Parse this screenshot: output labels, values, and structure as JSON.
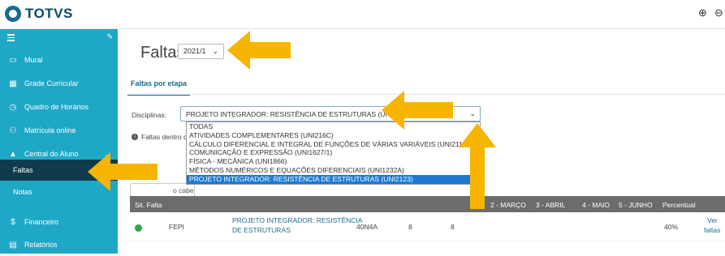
{
  "brand": {
    "name": "TOTVS"
  },
  "zoom": {
    "in_icon": "⊕",
    "out_icon": "⊖"
  },
  "sidebar": {
    "items": [
      {
        "label": "Mural",
        "icon": "monitor-icon"
      },
      {
        "label": "Grade Curricular",
        "icon": "grid-icon"
      },
      {
        "label": "Quadro de Horários",
        "icon": "clock-icon"
      },
      {
        "label": "Matrícula online",
        "icon": "user-plus-icon"
      },
      {
        "label": "Central do Aluno",
        "icon": "graduation-cap-icon"
      },
      {
        "label": "Faltas",
        "icon": ""
      },
      {
        "label": "Notas",
        "icon": ""
      },
      {
        "label": "Financeiro",
        "icon": "dollar-icon"
      },
      {
        "label": "Relatórios",
        "icon": "document-icon"
      }
    ]
  },
  "main": {
    "title": "Faltas:",
    "period": "2021/1",
    "tab": "Faltas por etapa",
    "disciplinas_label": "Disciplinas:",
    "disciplinas_value": "PROJETO INTEGRADOR: RESISTÊNCIA DE ESTRUTURAS (UNI2123)",
    "disciplinas_options": [
      "TODAS",
      "ATIVIDADES COMPLEMENTARES (UNI216C)",
      "CÁLCULO DIFERENCIAL E INTEGRAL DE FUNÇÕES DE VÁRIAS VARIÁVEIS (UNI2118A)",
      "COMUNICAÇÃO E EXPRESSÃO (UNI1627/1)",
      "FÍSICA - MECÂNICA (UNI1866)",
      "MÉTODOS NUMÉRICOS E EQUAÇÕES DIFERENCIAIS (UNI1232A)",
      "PROJETO INTEGRADOR: RESISTÊNCIA DE ESTRUTURAS (UNI2123)"
    ],
    "info_text": "Faltas dentro d",
    "cabecalho_label": "o cabe",
    "table": {
      "headers": [
        "Sit. Falta",
        "2 - MARÇO",
        "3 - ABRIL",
        "4 - MAIO",
        "5 - JUNHO",
        "Percentual"
      ],
      "row": {
        "code": "FEPI",
        "discipline_line1": "PROJETO INTEGRADOR: RESISTÊNCIA",
        "discipline_line2": "DE ESTRUTURAS",
        "turma": "40N4A",
        "val1": "8",
        "val2": "8",
        "percent": "40%",
        "link1": "Ver",
        "link2": "faltas"
      }
    }
  },
  "colors": {
    "sidebar": "#1fa7c6",
    "active": "#0f3b4d",
    "arrow": "#f7b400"
  }
}
